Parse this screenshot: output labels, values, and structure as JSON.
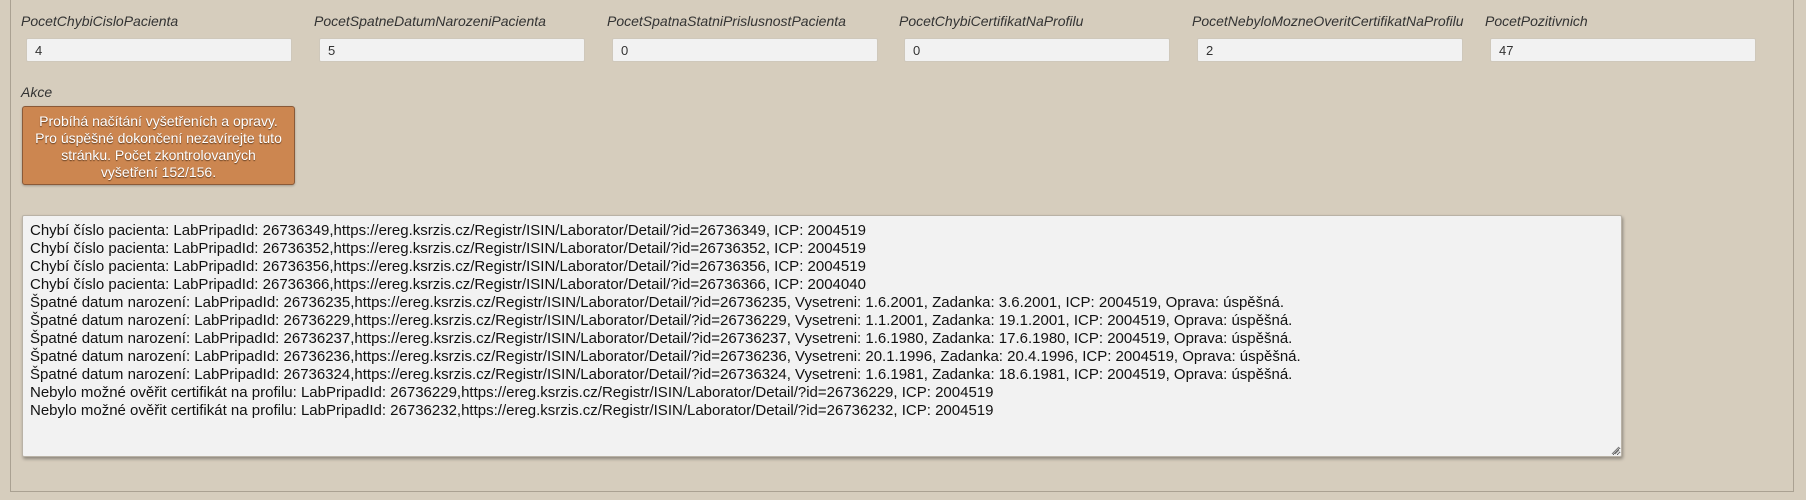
{
  "stats": [
    {
      "label": "PocetChybiCisloPacienta",
      "value": "4"
    },
    {
      "label": "PocetSpatneDatumNarozeniPacienta",
      "value": "5"
    },
    {
      "label": "PocetSpatnaStatniPrislusnostPacienta",
      "value": "0"
    },
    {
      "label": "PocetChybiCertifikatNaProfilu",
      "value": "0"
    },
    {
      "label": "PocetNebyloMozneOveritCertifikatNaProfilu",
      "value": "2"
    },
    {
      "label": "PocetPozitivnich",
      "value": "47"
    }
  ],
  "actions": {
    "label": "Akce",
    "button_label": "Probíhá načítání vyšetřeních a opravy. Pro úspěšné dokončení nezavírejte tuto stránku. Počet zkontrolovaných vyšetření 152/156."
  },
  "log": {
    "text": "Chybí číslo pacienta: LabPripadId: 26736349,https://ereg.ksrzis.cz/Registr/ISIN/Laborator/Detail/?id=26736349, ICP: 2004519\nChybí číslo pacienta: LabPripadId: 26736352,https://ereg.ksrzis.cz/Registr/ISIN/Laborator/Detail/?id=26736352, ICP: 2004519\nChybí číslo pacienta: LabPripadId: 26736356,https://ereg.ksrzis.cz/Registr/ISIN/Laborator/Detail/?id=26736356, ICP: 2004519\nChybí číslo pacienta: LabPripadId: 26736366,https://ereg.ksrzis.cz/Registr/ISIN/Laborator/Detail/?id=26736366, ICP: 2004040\nŠpatné datum narození: LabPripadId: 26736235,https://ereg.ksrzis.cz/Registr/ISIN/Laborator/Detail/?id=26736235, Vysetreni: 1.6.2001, Zadanka: 3.6.2001, ICP: 2004519, Oprava: úspěšná.\nŠpatné datum narození: LabPripadId: 26736229,https://ereg.ksrzis.cz/Registr/ISIN/Laborator/Detail/?id=26736229, Vysetreni: 1.1.2001, Zadanka: 19.1.2001, ICP: 2004519, Oprava: úspěšná.\nŠpatné datum narození: LabPripadId: 26736237,https://ereg.ksrzis.cz/Registr/ISIN/Laborator/Detail/?id=26736237, Vysetreni: 1.6.1980, Zadanka: 17.6.1980, ICP: 2004519, Oprava: úspěšná.\nŠpatné datum narození: LabPripadId: 26736236,https://ereg.ksrzis.cz/Registr/ISIN/Laborator/Detail/?id=26736236, Vysetreni: 20.1.1996, Zadanka: 20.4.1996, ICP: 2004519, Oprava: úspěšná.\nŠpatné datum narození: LabPripadId: 26736324,https://ereg.ksrzis.cz/Registr/ISIN/Laborator/Detail/?id=26736324, Vysetreni: 1.6.1981, Zadanka: 18.6.1981, ICP: 2004519, Oprava: úspěšná.\nNebylo možné ověřit certifikát na profilu: LabPripadId: 26736229,https://ereg.ksrzis.cz/Registr/ISIN/Laborator/Detail/?id=26736229, ICP: 2004519\nNebylo možné ověřit certifikát na profilu: LabPripadId: 26736232,https://ereg.ksrzis.cz/Registr/ISIN/Laborator/Detail/?id=26736232, ICP: 2004519"
  },
  "icons": {
    "resize_handle": "resize-grip-icon"
  }
}
